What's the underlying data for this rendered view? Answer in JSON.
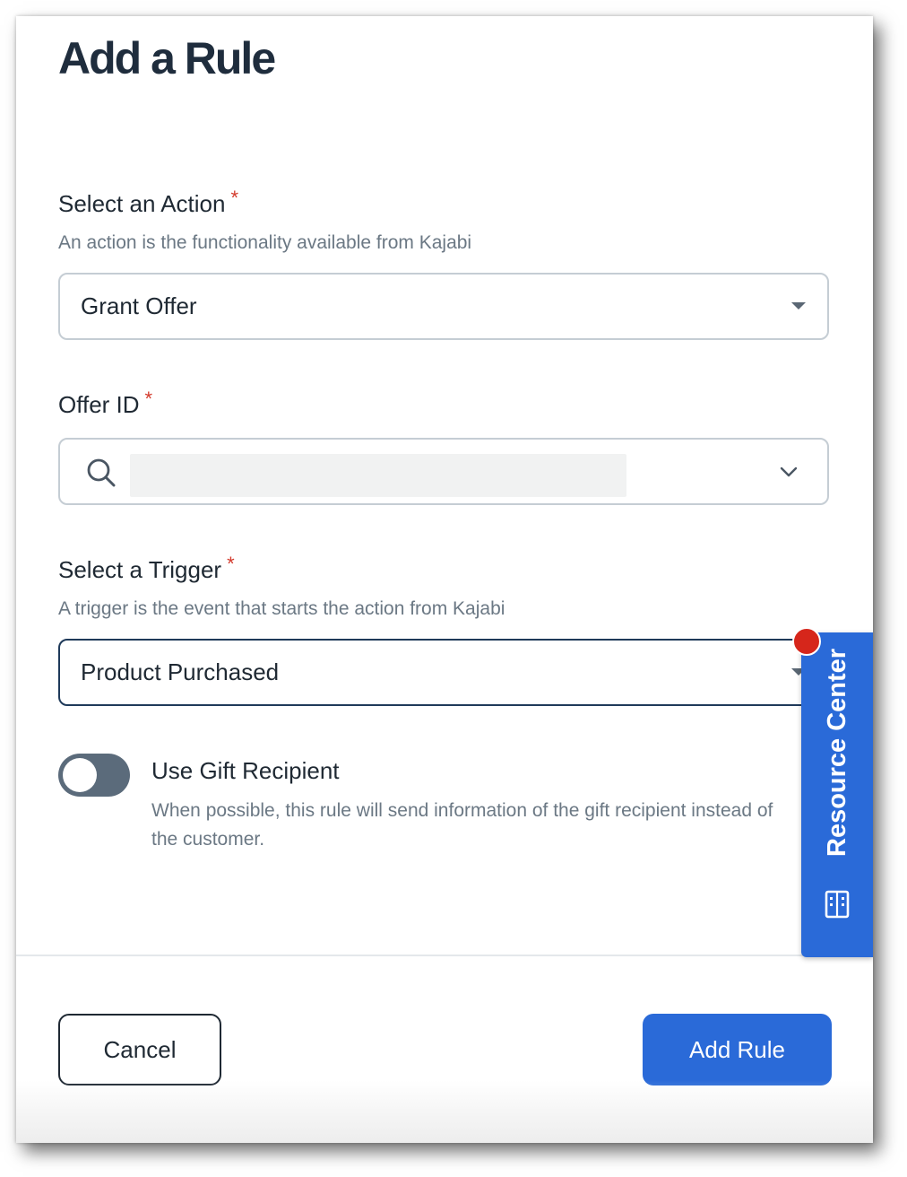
{
  "modal": {
    "title": "Add a Rule",
    "action": {
      "label": "Select an Action",
      "required_mark": "*",
      "help": "An action is the functionality available from Kajabi",
      "selected": "Grant Offer"
    },
    "offer": {
      "label": "Offer ID",
      "required_mark": "*",
      "search_value": ""
    },
    "trigger": {
      "label": "Select a Trigger",
      "required_mark": "*",
      "help": "A trigger is the event that starts the action from Kajabi",
      "selected": "Product Purchased"
    },
    "gift_toggle": {
      "title": "Use Gift Recipient",
      "description": "When possible, this rule will send information of the gift recipient instead of the customer.",
      "enabled": false
    },
    "buttons": {
      "cancel": "Cancel",
      "add": "Add Rule"
    }
  },
  "resource_center": {
    "label": "Resource Center",
    "icon": "building-icon",
    "badge_color": "#d6261b"
  },
  "colors": {
    "accent": "#2a6ad8",
    "title": "#1f2d3d",
    "toggle_off": "#5b6b7b"
  }
}
